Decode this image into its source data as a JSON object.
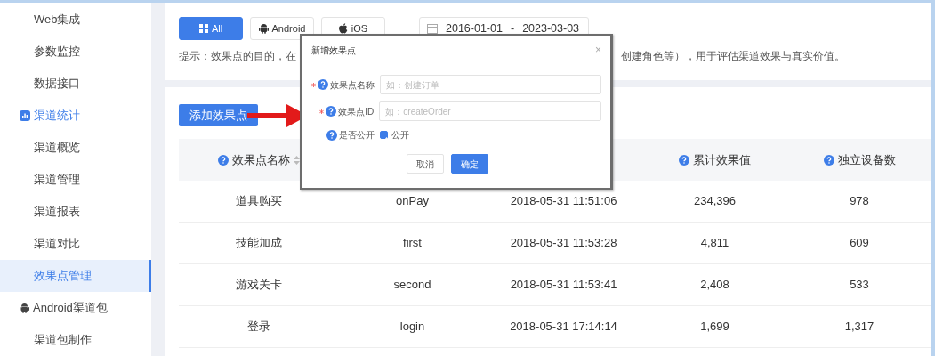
{
  "sidebar": {
    "items": [
      {
        "label": "Web集成",
        "kind": "item",
        "selected": false
      },
      {
        "label": "参数监控",
        "kind": "item",
        "selected": false
      },
      {
        "label": "数据接口",
        "kind": "item",
        "selected": false
      },
      {
        "label": "渠道统计",
        "kind": "group",
        "active": true,
        "children": [
          {
            "label": "渠道概览",
            "selected": false
          },
          {
            "label": "渠道管理",
            "selected": false
          },
          {
            "label": "渠道报表",
            "selected": false
          },
          {
            "label": "渠道对比",
            "selected": false
          },
          {
            "label": "效果点管理",
            "selected": true
          }
        ]
      },
      {
        "label": "Android渠道包",
        "kind": "group",
        "active": false,
        "children": [
          {
            "label": "渠道包制作",
            "selected": false
          }
        ]
      }
    ]
  },
  "platforms": [
    {
      "label": "All",
      "selected": true
    },
    {
      "label": "Android",
      "selected": false
    },
    {
      "label": "iOS",
      "selected": false
    }
  ],
  "date_range": {
    "start": "2016-01-01",
    "separator": "-",
    "end": "2023-03-03"
  },
  "hint": [
    "提示：效果点的目的，在",
    "创建角色等），用于评估渠道效果与真实价值。"
  ],
  "add_button": "添加效果点",
  "table": {
    "columns": [
      {
        "label": "效果点名称",
        "sortable": true
      },
      {},
      {},
      {
        "label": "累计效果值",
        "sortable": false
      },
      {
        "label": "独立设备数",
        "sortable": false
      }
    ],
    "rows": [
      [
        "道具购买",
        "onPay",
        "2018-05-31 11:51:06",
        "234,396",
        "978"
      ],
      [
        "技能加成",
        "first",
        "2018-05-31 11:53:28",
        "4,811",
        "609"
      ],
      [
        "游戏关卡",
        "second",
        "2018-05-31 11:53:41",
        "2,408",
        "533"
      ],
      [
        "登录",
        "login",
        "2018-05-31 17:14:14",
        "1,699",
        "1,317"
      ]
    ]
  },
  "dialog": {
    "title": "新增效果点",
    "close": "×",
    "fields": [
      {
        "kind": "input",
        "label": "效果点名称",
        "required": true,
        "placeholder": "如：创建订单"
      },
      {
        "kind": "input",
        "label": "效果点ID",
        "required": true,
        "placeholder": "如：createOrder"
      },
      {
        "kind": "checkbox",
        "label": "是否公开",
        "required": false,
        "option": "公开",
        "checked": true
      }
    ],
    "buttons": [
      {
        "label": "取消",
        "primary": false
      },
      {
        "label": "确定",
        "primary": true
      }
    ]
  }
}
